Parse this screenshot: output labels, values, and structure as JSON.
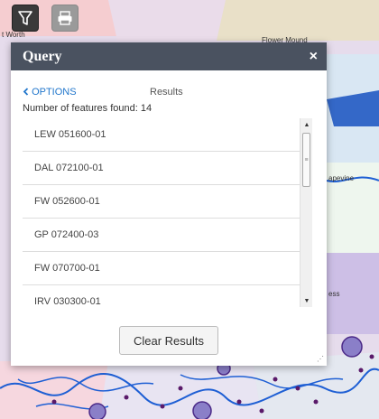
{
  "map": {
    "labels": {
      "tl": "t Worth",
      "tm": "Flower Mound",
      "right1": "apevine",
      "right2": "ess"
    }
  },
  "panel": {
    "title": "Query",
    "close_glyph": "×",
    "options_link": "OPTIONS",
    "results_label": "Results",
    "count_text": "Number of features found: 14",
    "items": [
      "LEW 051600-01",
      "DAL 072100-01",
      "FW 052600-01",
      "GP 072400-03",
      "FW 070700-01",
      "IRV 030300-01"
    ],
    "clear_button": "Clear Results"
  },
  "icons": {
    "toolbar": [
      "filter-icon",
      "print-icon"
    ],
    "panel": [
      "chevron-left-icon",
      "close-icon",
      "resize-grip-icon"
    ]
  }
}
